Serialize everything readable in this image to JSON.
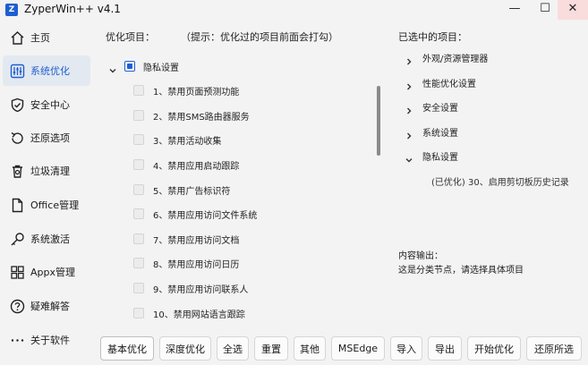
{
  "window": {
    "app_icon_text": "Z",
    "title": "ZyperWin++ v4.1",
    "minimize": "—",
    "maximize": "☐",
    "close": "✕"
  },
  "sidebar": {
    "items": [
      {
        "label": "主页",
        "icon": "home-icon"
      },
      {
        "label": "系统优化",
        "icon": "system-optimize-icon",
        "active": true
      },
      {
        "label": "安全中心",
        "icon": "shield-icon"
      },
      {
        "label": "还原选项",
        "icon": "restore-icon"
      },
      {
        "label": "垃圾清理",
        "icon": "trash-icon"
      },
      {
        "label": "Office管理",
        "icon": "document-icon"
      },
      {
        "label": "系统激活",
        "icon": "key-icon"
      },
      {
        "label": "Appx管理",
        "icon": "apps-icon"
      },
      {
        "label": "疑难解答",
        "icon": "help-icon"
      },
      {
        "label": "关于软件",
        "icon": "more-icon"
      }
    ]
  },
  "main": {
    "header": "优化项目：",
    "hint": "（提示：优化过的项目前面会打勾）",
    "root_label": "隐私设置",
    "items": [
      "1、禁用页面预测功能",
      "2、禁用SMS路由器服务",
      "3、禁用活动收集",
      "4、禁用应用启动跟踪",
      "5、禁用广告标识符",
      "6、禁用应用访问文件系统",
      "7、禁用应用访问文档",
      "8、禁用应用访问日历",
      "9、禁用应用访问联系人",
      "10、禁用网站语言跟踪"
    ]
  },
  "selected": {
    "header": "已选中的项目：",
    "groups": [
      "外观/资源管理器",
      "性能优化设置",
      "安全设置",
      "系统设置",
      "隐私设置"
    ],
    "expanded_detail": "(已优化) 30、启用剪切板历史记录"
  },
  "output": {
    "label": "内容输出：",
    "text": "这是分类节点，请选择具体项目"
  },
  "buttons": [
    "基本优化",
    "深度优化",
    "全选",
    "重置",
    "其他",
    "MSEdge",
    "导入",
    "导出",
    "开始优化",
    "还原所选"
  ],
  "colors": {
    "accent": "#1e5fd0",
    "active_nav_bg": "#e3e9f1",
    "close_hover_bg": "#f9dcdc",
    "background": "#f3f3f3"
  }
}
